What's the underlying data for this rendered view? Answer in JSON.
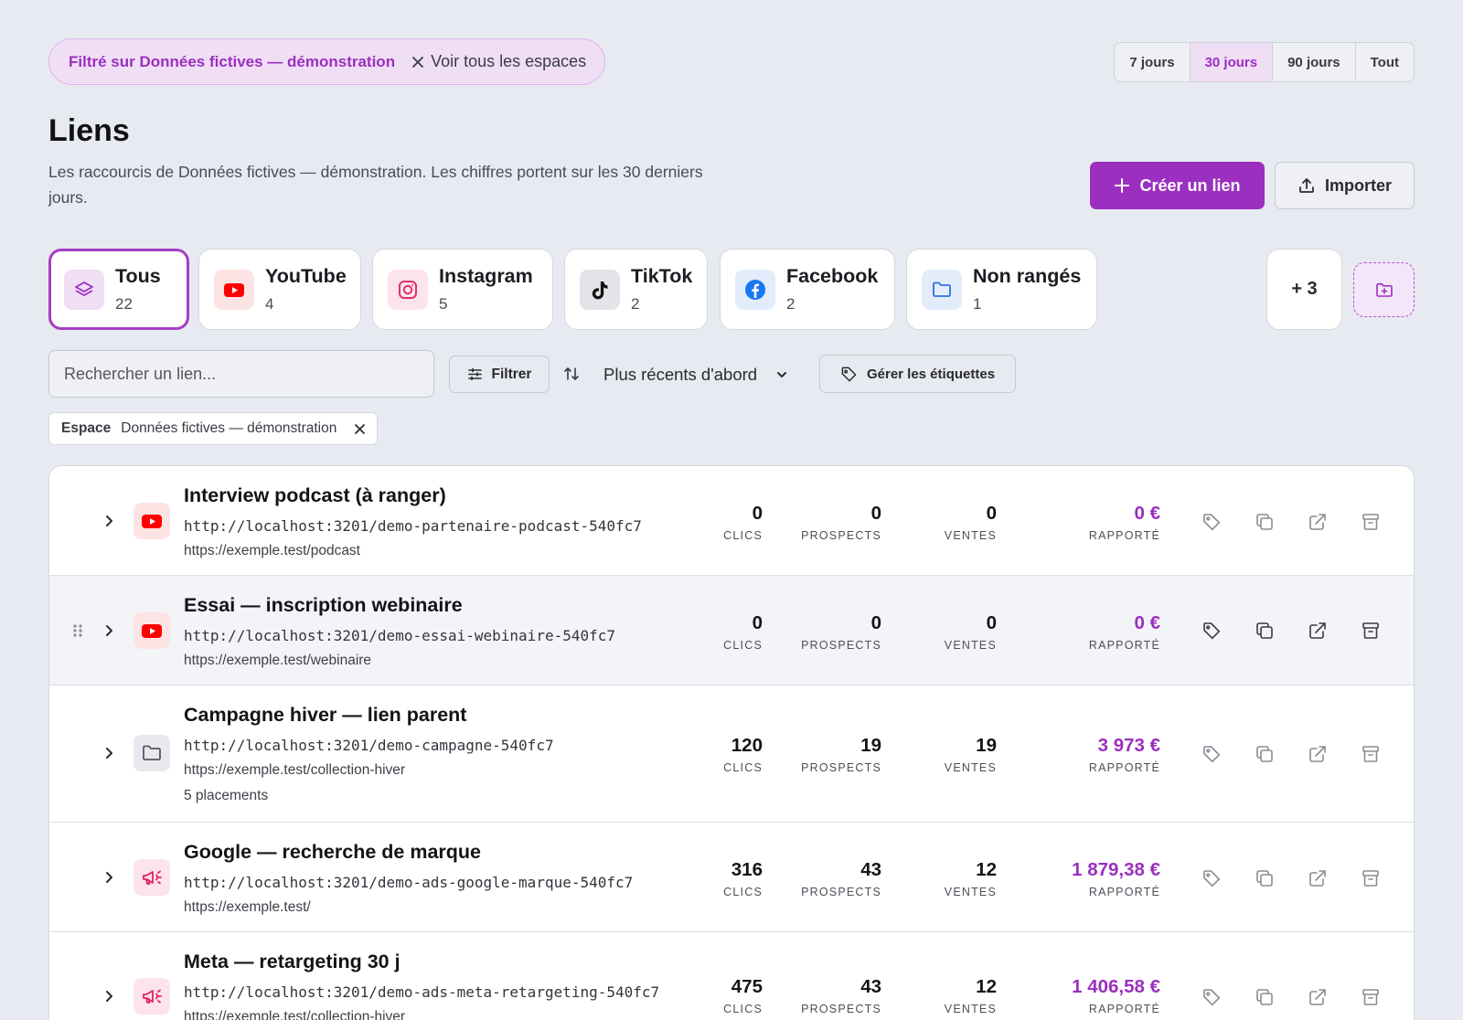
{
  "filter_chip": {
    "label": "Filtré sur Données fictives — démonstration",
    "clear_label": "Voir tous les espaces"
  },
  "periods": [
    "7 jours",
    "30 jours",
    "90 jours",
    "Tout"
  ],
  "active_period": "30 jours",
  "page": {
    "title": "Liens",
    "description": "Les raccourcis de Données fictives — démonstration. Les chiffres portent sur les 30 derniers jours."
  },
  "actions": {
    "create_label": "Créer un lien",
    "import_label": "Importer"
  },
  "categories": [
    {
      "name": "Tous",
      "count": "22",
      "icon": "layers-icon",
      "active": true
    },
    {
      "name": "YouTube",
      "count": "4",
      "icon": "youtube-icon"
    },
    {
      "name": "Instagram",
      "count": "5",
      "icon": "instagram-icon"
    },
    {
      "name": "TikTok",
      "count": "2",
      "icon": "tiktok-icon"
    },
    {
      "name": "Facebook",
      "count": "2",
      "icon": "facebook-icon"
    },
    {
      "name": "Non rangés",
      "count": "1",
      "icon": "folder-icon"
    }
  ],
  "more_categories": "+ 3",
  "toolbar": {
    "search_placeholder": "Rechercher un lien...",
    "filter_label": "Filtrer",
    "sort_label": "Plus récents d'abord",
    "tags_label": "Gérer les étiquettes"
  },
  "space_filter": {
    "key": "Espace",
    "value": "Données fictives — démonstration"
  },
  "stat_labels": {
    "clicks": "CLICS",
    "leads": "PROSPECTS",
    "sales": "VENTES",
    "revenue": "RAPPORTÉ"
  },
  "links": [
    {
      "name": "Interview podcast (à ranger)",
      "short_url": "http://localhost:3201/demo-partenaire-podcast-540fc7",
      "destination": "https://exemple.test/podcast",
      "extra": "",
      "icon": "youtube-icon",
      "clicks": "0",
      "leads": "0",
      "sales": "0",
      "revenue": "0 €"
    },
    {
      "name": "Essai — inscription webinaire",
      "short_url": "http://localhost:3201/demo-essai-webinaire-540fc7",
      "destination": "https://exemple.test/webinaire",
      "extra": "",
      "icon": "youtube-icon",
      "clicks": "0",
      "leads": "0",
      "sales": "0",
      "revenue": "0 €"
    },
    {
      "name": "Campagne hiver — lien parent",
      "short_url": "http://localhost:3201/demo-campagne-540fc7",
      "destination": "https://exemple.test/collection-hiver",
      "extra": "5 placements",
      "icon": "folder-icon",
      "clicks": "120",
      "leads": "19",
      "sales": "19",
      "revenue": "3 973 €"
    },
    {
      "name": "Google — recherche de marque",
      "short_url": "http://localhost:3201/demo-ads-google-marque-540fc7",
      "destination": "https://exemple.test/",
      "extra": "",
      "icon": "megaphone-icon",
      "clicks": "316",
      "leads": "43",
      "sales": "12",
      "revenue": "1 879,38 €"
    },
    {
      "name": "Meta — retargeting 30 j",
      "short_url": "http://localhost:3201/demo-ads-meta-retargeting-540fc7",
      "destination": "https://exemple.test/collection-hiver",
      "extra": "",
      "icon": "megaphone-icon",
      "clicks": "475",
      "leads": "43",
      "sales": "12",
      "revenue": "1 406,58 €"
    }
  ],
  "colors": {
    "accent": "#9b2fbf",
    "background": "#e8eaf1",
    "youtube": "#ff0000",
    "facebook": "#1877f2"
  }
}
